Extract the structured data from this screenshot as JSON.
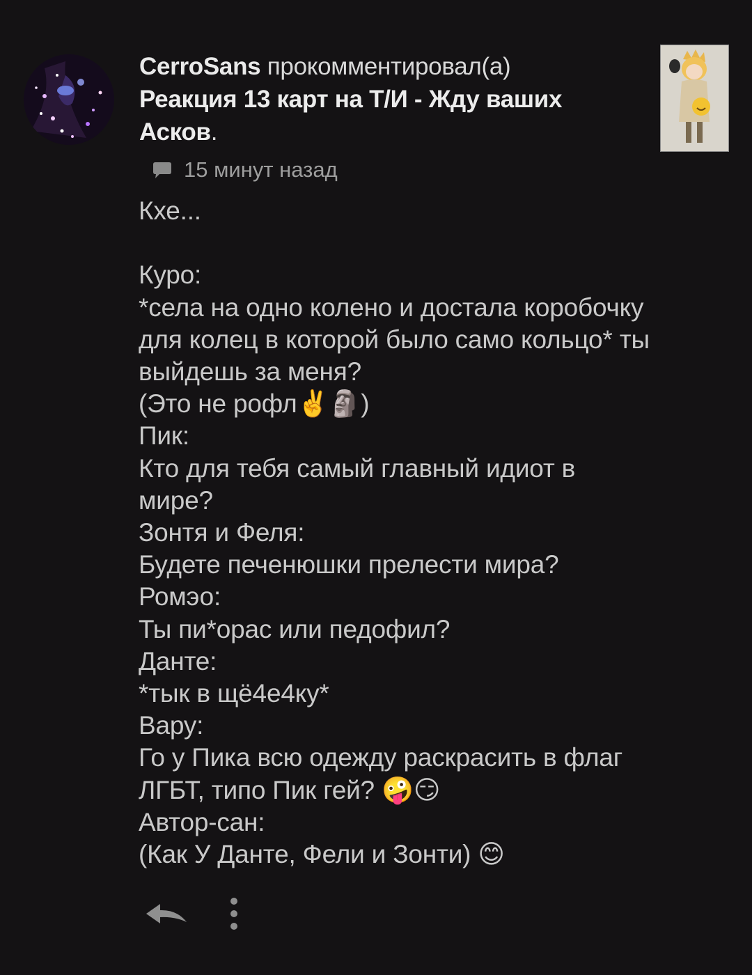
{
  "comment": {
    "author": "CerroSans",
    "action": " прокомментировал(а)",
    "post_title": "Реакция 13 карт на Т/И - Жду ваших Асков",
    "title_end": ".",
    "time": "15 минут назад",
    "body": "Кхе...\n\nКуро:\n*села на одно колено и достала коробочку для колец в которой было само кольцо* ты выйдешь за меня?\n(Это не рофл✌️🗿)\nПик:\nКто для тебя самый главный идиот в мире?\nЗонтя и Феля:\nБудете печенюшки прелести мира?\nРомэо:\nТы пи*орас или педофил?\nДанте:\n*тык в щё4е4ку*\nВару:\nГо у Пика всю одежду раскрасить в флаг ЛГБТ, типо Пик гей? 🤪😏\nАвтор-сан:\n(Как У Данте, Фели и Зонти) 😊"
  },
  "icons": {
    "avatar": "avatar",
    "thumbnail": "post-thumbnail",
    "comment": "comment-icon",
    "reply": "reply-icon",
    "more": "more-icon"
  },
  "colors": {
    "background": "#141214",
    "text": "#c9c9c9",
    "meta": "#9e9e9e"
  }
}
